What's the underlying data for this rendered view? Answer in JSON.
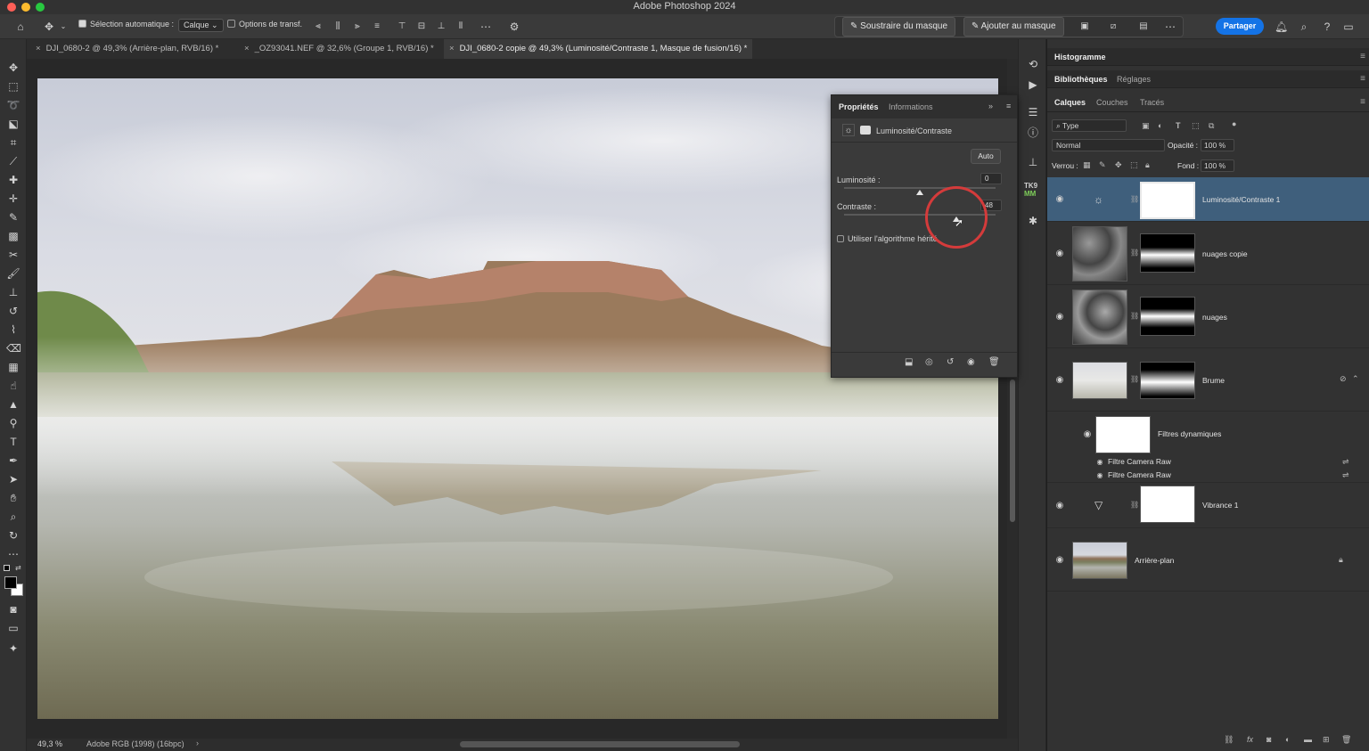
{
  "app": {
    "title": "Adobe Photoshop 2024"
  },
  "options_bar": {
    "auto_select_label": "Sélection automatique :",
    "auto_select_value": "Calque",
    "transform_options_label": "Options de transf.",
    "subtract_mask_label": "Soustraire du masque",
    "add_mask_label": "Ajouter au masque",
    "share_label": "Partager"
  },
  "tabs": [
    {
      "label": "DJI_0680-2 @ 49,3% (Arrière-plan, RVB/16) *"
    },
    {
      "label": "_OZ93041.NEF @ 32,6% (Groupe 1, RVB/16) *"
    },
    {
      "label": "DJI_0680-2 copie @ 49,3% (Luminosité/Contraste 1, Masque de fusion/16) *"
    }
  ],
  "status": {
    "zoom": "49,3 %",
    "profile": "Adobe RGB (1998) (16bpc)"
  },
  "properties_panel": {
    "tab_properties": "Propriétés",
    "tab_info": "Informations",
    "adjustment_name": "Luminosité/Contraste",
    "auto_label": "Auto",
    "brightness_label": "Luminosité :",
    "brightness_value": "0",
    "brightness_level": 0.5,
    "contrast_label": "Contraste :",
    "contrast_value": "48",
    "contrast_level": 0.74,
    "legacy_label": "Utiliser l'algorithme hérité"
  },
  "right_panels": {
    "histogram_tab": "Histogramme",
    "libraries_tab": "Bibliothèques",
    "adjustments_tab": "Réglages",
    "layers_tab": "Calques",
    "channels_tab": "Couches",
    "paths_tab": "Tracés",
    "filter_type": "Type",
    "blend_mode": "Normal",
    "opacity_label": "Opacité :",
    "opacity_value": "100 %",
    "lock_label": "Verrou :",
    "fill_label": "Fond :",
    "fill_value": "100 %"
  },
  "layers": [
    {
      "name": "Luminosité/Contraste 1",
      "selected": true
    },
    {
      "name": "nuages copie"
    },
    {
      "name": "nuages"
    },
    {
      "name": "Brume"
    },
    {
      "name": "Filtres dynamiques"
    },
    {
      "name": "Filtre Camera Raw"
    },
    {
      "name": "Filtre Camera Raw"
    },
    {
      "name": "Vibrance 1"
    },
    {
      "name": "Arrière-plan"
    }
  ],
  "colors": {
    "accent": "#1473e6",
    "selected_layer": "#3f5f7c",
    "highlight_circle": "#d43b3b"
  }
}
